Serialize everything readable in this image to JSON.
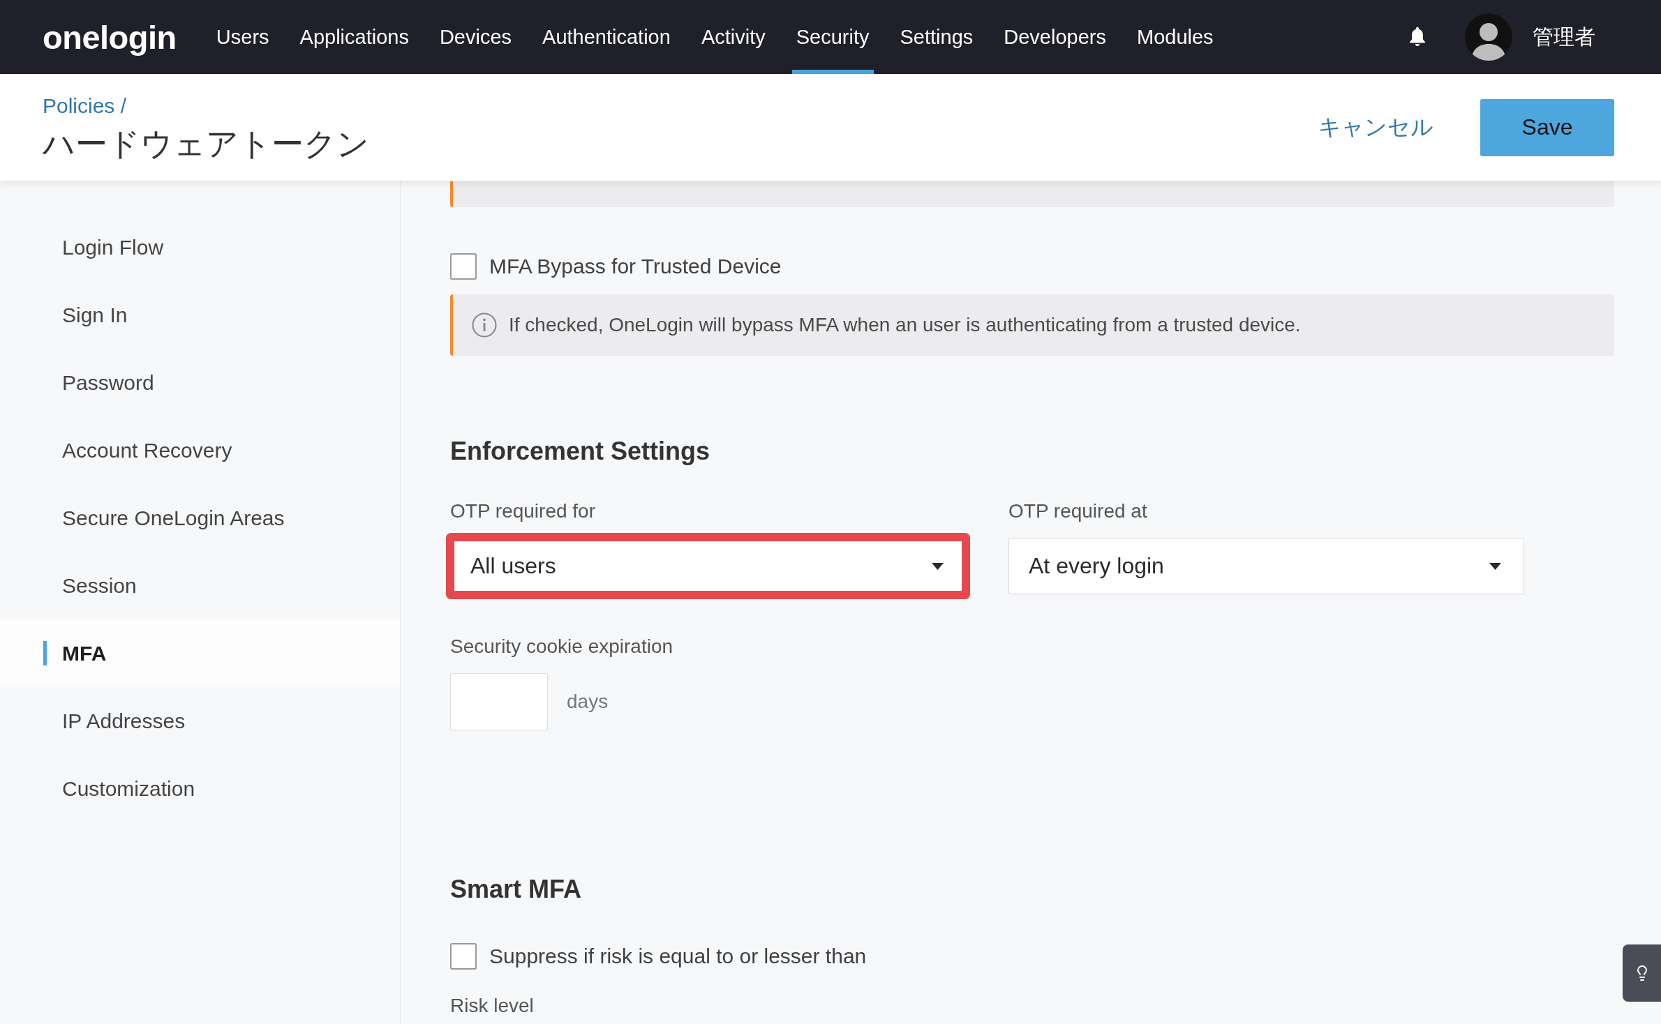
{
  "top_nav": {
    "logo": "onelogin",
    "items": [
      {
        "label": "Users",
        "selected": false
      },
      {
        "label": "Applications",
        "selected": false
      },
      {
        "label": "Devices",
        "selected": false
      },
      {
        "label": "Authentication",
        "selected": false
      },
      {
        "label": "Activity",
        "selected": false
      },
      {
        "label": "Security",
        "selected": true
      },
      {
        "label": "Settings",
        "selected": false
      },
      {
        "label": "Developers",
        "selected": false
      },
      {
        "label": "Modules",
        "selected": false
      }
    ],
    "user_name": "管理者"
  },
  "header": {
    "breadcrumb": "Policies /",
    "title": "ハードウェアトークン",
    "cancel_label": "キャンセル",
    "save_label": "Save"
  },
  "sidebar": {
    "items": [
      {
        "label": "Login Flow",
        "selected": false
      },
      {
        "label": "Sign In",
        "selected": false
      },
      {
        "label": "Password",
        "selected": false
      },
      {
        "label": "Account Recovery",
        "selected": false
      },
      {
        "label": "Secure OneLogin Areas",
        "selected": false
      },
      {
        "label": "Session",
        "selected": false
      },
      {
        "label": "MFA",
        "selected": true
      },
      {
        "label": "IP Addresses",
        "selected": false
      },
      {
        "label": "Customization",
        "selected": false
      }
    ]
  },
  "content": {
    "bypass": {
      "label": "MFA Bypass for Trusted Device",
      "checked": false,
      "info": "If checked, OneLogin will bypass MFA when an user is authenticating from a trusted device."
    },
    "enforcement": {
      "heading": "Enforcement Settings",
      "selects": [
        {
          "label": "OTP required for",
          "value": "All users",
          "highlighted": true
        },
        {
          "label": "OTP required at",
          "value": "At every login",
          "highlighted": false
        }
      ],
      "cookie": {
        "label": "Security cookie expiration",
        "unit": "days"
      }
    },
    "smart_mfa": {
      "heading": "Smart MFA",
      "suppress": {
        "label": "Suppress if risk is equal to or lesser than",
        "checked": false
      },
      "risk_label": "Risk level"
    }
  }
}
